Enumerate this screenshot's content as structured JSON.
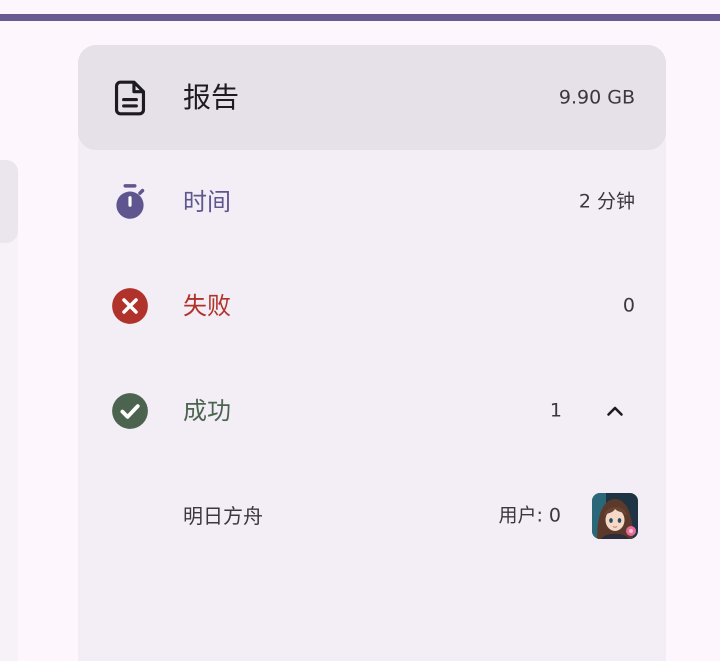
{
  "header": {
    "title": "报告",
    "size": "9.90 GB",
    "icon": "document-icon"
  },
  "stats": {
    "time": {
      "label": "时间",
      "value": "2 分钟",
      "icon": "timer-icon"
    },
    "failed": {
      "label": "失败",
      "value": "0",
      "icon": "error-circle-icon"
    },
    "success": {
      "label": "成功",
      "value": "1",
      "icon": "check-circle-icon",
      "expanded": true,
      "toggle_icon": "chevron-up-icon"
    }
  },
  "success_items": [
    {
      "name": "明日方舟",
      "users": "用户: 0",
      "icon": "game-avatar-icon"
    }
  ],
  "colors": {
    "top_bar": "#675b91",
    "accent": "#5f5690",
    "error": "#b0322a",
    "success": "#4c644f",
    "text": "#1d1b20"
  }
}
